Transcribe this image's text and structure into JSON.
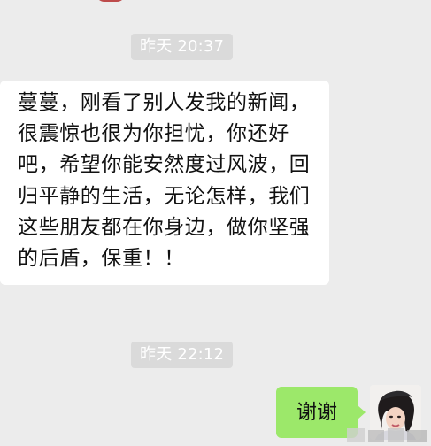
{
  "chat": {
    "messages": [
      {
        "type": "timestamp",
        "text": "昨天 20:37"
      },
      {
        "type": "incoming",
        "text": "蔓蔓，刚看了别人发我的新闻，很震惊也很为你担忧，你还好吧，希望你能安然度过风波，回归平静的生活，无论怎样，我们这些朋友都在你身边，做你坚强的后盾，保重！！"
      },
      {
        "type": "timestamp",
        "text": "昨天 22:12"
      },
      {
        "type": "outgoing",
        "text": "谢谢"
      }
    ]
  },
  "icons": {
    "sender_avatar": "person-photo-avatar",
    "watermark": "watermark-logo-icon"
  },
  "colors": {
    "background": "#ececec",
    "incoming_bubble": "#ffffff",
    "outgoing_bubble": "#9ce86a",
    "timestamp_badge": "#dadada",
    "timestamp_text": "#ffffff"
  }
}
